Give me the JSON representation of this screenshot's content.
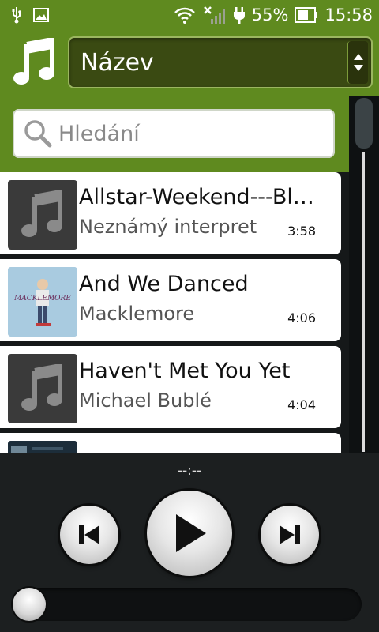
{
  "status_bar": {
    "battery_percent": "55%",
    "time": "15:58",
    "icons": [
      "usb-icon",
      "image-notification-icon",
      "wifi-icon",
      "signal-icon",
      "charging-icon",
      "battery-icon"
    ]
  },
  "header": {
    "app_icon": "music-note-icon",
    "sort_selected": "Název"
  },
  "search": {
    "placeholder": "Hledání",
    "value": ""
  },
  "tracks": [
    {
      "title": "Allstar-Weekend---Black-Hole",
      "title_display": "Allstar-Weekend---Bla...",
      "artist": "Neznámý interpret",
      "duration": "3:58",
      "art": "music-note-placeholder"
    },
    {
      "title": "And We Danced",
      "artist": "Macklemore",
      "duration": "4:06",
      "art": "album-cover-macklemore",
      "art_caption": "MACKLEMORE"
    },
    {
      "title": "Haven't Met You Yet",
      "artist": "Michael Bublé",
      "duration": "4:04",
      "art": "music-note-placeholder"
    }
  ],
  "player": {
    "time": "--:--",
    "progress_fraction": 0
  },
  "colors": {
    "accent_green": "#5f8a1f",
    "spinner_dark": "#3a4a12",
    "background_dark": "#1c1f20"
  }
}
